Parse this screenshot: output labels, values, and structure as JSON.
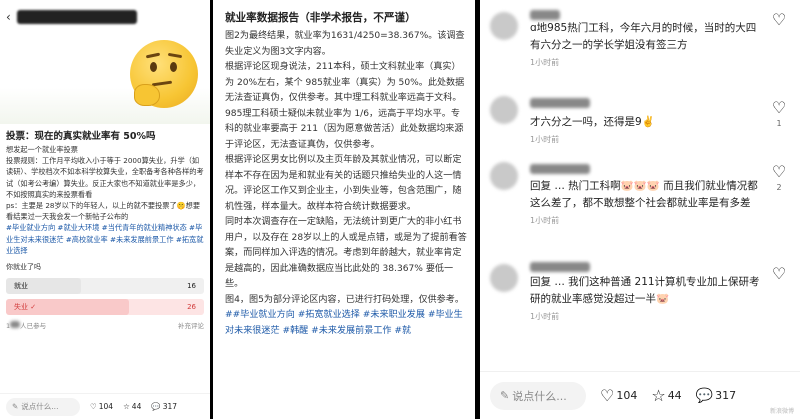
{
  "panel1": {
    "hero_emoji": "thinking-face",
    "title": "投票：现在的真实就业率有 50%吗",
    "paragraphs": [
      "想发起一个就业率投票",
      "投票规则：工作月平均收入小于等于 2000算失业，升学（如读研）、学校档次不如本科学校算失业，全职备考各种各样的考试（如考公考编）算失业。反正大家也不知道就业率是多少，不如按照真实的来投票看看",
      "ps：主要是 28岁以下的年轻人，以上的就不要投票了🤫想要看结果过一天我会发一个新帖子公布的"
    ],
    "tags": "#毕业就业方向 #就业大环境 #当代青年的就业精神状态 #毕业生对未来很迷茫 #高校就业率 #未来发展前景工作 #拓宽就业选择",
    "poll": {
      "question": "你就业了吗",
      "options": [
        {
          "label": "就业",
          "count": "16",
          "share": 0.38,
          "selected": false
        },
        {
          "label": "失业 ✓",
          "count": "26",
          "share": 0.62,
          "selected": true
        }
      ],
      "participants": "人已参与",
      "prefix": "1",
      "note": "补充评论"
    },
    "bottom": {
      "say": "说点什么...",
      "likes": "104",
      "stars": "44",
      "comments": "317"
    }
  },
  "panel2": {
    "title": "就业率数据报告（非学术报告，不严谨）",
    "paragraphs": [
      "图2为最终结果，就业率为1631/4250=38.367%。该调查失业定义为图3文字内容。",
      "根据评论区现身说法，211本科，硕士文科就业率（真实）为 20%左右，某个 985就业率（真实）为 50%。此处数据无法查证真伪，仅供参考。其中理工科就业率远高于文科。985理工科硕士疑似未就业率为 1/6，远高于平均水平。专科的就业率要高于 211（因为愿意做苦活）此处数据均来源于评论区，无法查证真伪，仅供参考。",
      "根据评论区男女比例以及主页年龄及其就业情况，可以断定样本不存在因为是和就业有关的话题只推给失业的人这一情况。评论区工作又到企业主，小到失业等，包含范围广，随机性强，样本量大。故样本符合统计数据要求。",
      "同时本次调查存在一定缺陷，无法统计到更广大的非小红书用户，以及存在 28岁以上的人或是点错，或是为了提前看答案，而同样加入评选的情况。考虑到年龄越大，就业率肯定是越高的，因此准确数据应当比此处的 38.367% 要低一些。",
      "图4，图5为部分评论区内容，已进行打码处理，仅供参考。"
    ],
    "tags": "##毕业就业方向 #拓宽就业选择 #未来职业发展 #毕业生对未来很迷茫 #韩醒 #未来发展前景工作 #就"
  },
  "panel3": {
    "comments": [
      {
        "text": "ɑ地985热门工科，今年六月的时候，当时的大四有六分之一的学长学姐没有签三方",
        "time": "1小时前",
        "likes": ""
      },
      {
        "text": "才六分之一吗，还得是9✌️",
        "time": "1小时前",
        "likes": "1"
      },
      {
        "text": "回复 … 热门工科啊🐷🐷🐷 而且我们就业情况都这么差了，都不敢想整个社会都就业率是有多差",
        "time": "1小时前",
        "likes": "2"
      },
      {
        "text": "回复 … 我们这种普通 211计算机专业加上保研考研的就业率感觉没超过一半🐷",
        "time": "1小时前",
        "likes": ""
      }
    ],
    "bottom": {
      "say": "说点什么...",
      "likes": "104",
      "stars": "44",
      "comments": "317"
    },
    "watermark": "新浪微博"
  }
}
